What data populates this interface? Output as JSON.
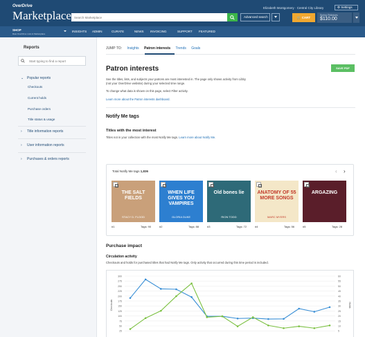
{
  "header": {
    "brand_small": "OverDrive",
    "brand_big": "Marketplace",
    "search_placeholder": "Search Marketplace",
    "advanced_search": "Advanced search",
    "user": "Elizabeth Montgomery · Central City Library",
    "settings": "Settings",
    "cart": "CART",
    "funds_label": "Spring Releases",
    "funds_amount": "$110.00"
  },
  "nav": {
    "shop": "SHOP",
    "shop_sub": "Raw OverDrive Lists & Marketplace",
    "items": [
      "INSIGHTS",
      "ADMIN",
      "CURATE",
      "NEWS",
      "INVOICING",
      "SUPPORT",
      "FEATURED"
    ]
  },
  "sidebar": {
    "title": "Reports",
    "search_placeholder": "Start typing to find a report",
    "groups": [
      {
        "label": "Popular reports",
        "expanded": true,
        "items": [
          "Checkouts",
          "Current holds",
          "Purchase orders",
          "Title status & usage"
        ]
      },
      {
        "label": "Title information reports",
        "expanded": false
      },
      {
        "label": "User information reports",
        "expanded": false
      },
      {
        "label": "Purchases & orders reports",
        "expanded": false
      }
    ]
  },
  "jump": {
    "label": "JUMP TO:",
    "links": [
      "Insights",
      "Patron interests",
      "Trends",
      "Goals"
    ],
    "active": "Patron interests"
  },
  "main": {
    "title": "Patron interests",
    "save_pdf": "SAVE PDF",
    "desc1": "See the titles, lists, and subjects your patrons are most interested in. The page only shows activity from Libby",
    "desc2": "(not your OverDrive website) during your selected time range.",
    "desc3": "To change what data is shown on this page, select Filter activity.",
    "learn_more": "Learn more about the Patron interests dashboard.",
    "notify_title": "Notify Me tags",
    "interest_title": "Titles with the most interest",
    "interest_desc": "Titles not in your collection with the most Notify Me tags.",
    "interest_link": "Learn more about Notify Me.",
    "total_label": "Total Notify Me tags",
    "total_value": "1,836",
    "purchase_title": "Purchase impact",
    "circ_title": "Circulation activity",
    "circ_desc": "Checkouts and holds for purchased titles that had Notify Me tags. Only activity that occurred during this time period is included."
  },
  "books": [
    {
      "rank": "#1",
      "tags": "Tags: 90",
      "title": "THE SALT FIELDS",
      "author": "STACY D. FLOOD",
      "color": "#c9a07a"
    },
    {
      "rank": "#2",
      "tags": "Tags: 88",
      "title": "WHEN LIFE GIVES YOU VAMPIRES",
      "author": "GLORIA DUKE",
      "color": "#2d7fd0"
    },
    {
      "rank": "#3",
      "tags": "Tags: 72",
      "title": "Old bones lie",
      "author": "RION TODD",
      "color": "#2e6a78"
    },
    {
      "rank": "#4",
      "tags": "Tags: 56",
      "title": "ANATOMY OF 55 MORE SONGS",
      "author": "MARC MYERS",
      "color": "#f4e7c8"
    },
    {
      "rank": "#5",
      "tags": "Tags: 28",
      "title": "ARGAZING",
      "author": "",
      "color": "#5a1e2a"
    }
  ],
  "chart_data": {
    "type": "line",
    "y_left_ticks": [
      300,
      275,
      250,
      225,
      200,
      175,
      150,
      125,
      100,
      75,
      50,
      25
    ],
    "y_right_ticks": [
      60,
      55,
      50,
      45,
      40,
      35,
      30,
      25,
      20,
      15,
      10,
      5
    ],
    "ylabel_left": "Checkouts",
    "ylabel_right": "Holds",
    "ylim_left": [
      0,
      300
    ],
    "ylim_right": [
      0,
      60
    ],
    "series": [
      {
        "axis": "left",
        "color": "#3a8fd6",
        "values": [
          180,
          282,
          230,
          228,
          185,
          80,
          80,
          68,
          70,
          65,
          66,
          122,
          105,
          130
        ]
      },
      {
        "axis": "right",
        "color": "#7cc142",
        "values": [
          2,
          14,
          22,
          38,
          52,
          15,
          16,
          5,
          15,
          6,
          3,
          5,
          3,
          6
        ]
      }
    ]
  },
  "colors": {
    "header": "#1f4a74",
    "nav": "#2a5a8a",
    "accent": "#5bbf63",
    "cart": "#f0a830"
  }
}
